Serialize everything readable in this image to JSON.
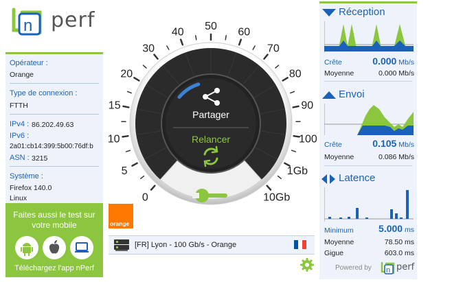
{
  "brand": {
    "name": "perf",
    "logo_letter": "n",
    "primary": "#1a62b8",
    "accent": "#8cc63f"
  },
  "sidebar": {
    "operator_label": "Opérateur :",
    "operator_value": "Orange",
    "connection_label": "Type de connexion :",
    "connection_value": "FTTH",
    "ipv4_label": "IPv4 :",
    "ipv4_value": "86.202.49.63",
    "ipv6_label": "IPv6 :",
    "ipv6_value": "2a01:cb14:399:5b00:76df:b",
    "asn_label": "ASN :",
    "asn_value": "3215",
    "system_label": "Système :",
    "system_browser": "Firefox 140.0",
    "system_os": "Linux"
  },
  "mobile_promo": {
    "title_line1": "Faites aussi le test sur",
    "title_line2": "votre mobile",
    "footer": "Téléchargez l'app nPerf",
    "icons": [
      "android-icon",
      "apple-icon",
      "desktop-icon"
    ]
  },
  "isp_logo": {
    "text": "orange",
    "color": "#ff7900"
  },
  "gauge": {
    "scale_labels": [
      "0",
      "5",
      "10",
      "15",
      "20",
      "30",
      "40",
      "50",
      "60",
      "70",
      "80",
      "90",
      "100",
      "1Gb",
      "10Gb"
    ],
    "share_label": "Partager",
    "restart_label": "Relancer",
    "progress": 0.18
  },
  "server": {
    "text": "[FR] Lyon - 100 Gb/s - Orange",
    "icons": [
      "server-icon",
      "france-flag-icon"
    ]
  },
  "results": {
    "reception": {
      "title": "Réception",
      "peak_label": "Crête",
      "peak_value": "0.000",
      "peak_unit": "Mb/s",
      "avg_label": "Moyenne",
      "avg_value": "0.000 Mb/s"
    },
    "upload": {
      "title": "Envoi",
      "peak_label": "Crête",
      "peak_value": "0.105",
      "peak_unit": "Mb/s",
      "avg_label": "Moyenne",
      "avg_value": "0.086 Mb/s"
    },
    "latency": {
      "title": "Latence",
      "min_label": "Minimum",
      "min_value": "5.000",
      "min_unit": "ms",
      "avg_label": "Moyenne",
      "avg_value": "78.50 ms",
      "jitter_label": "Gigue",
      "jitter_value": "603.0 ms"
    }
  },
  "footer": {
    "powered_by": "Powered by",
    "brand": "perf",
    "brand_letter": "n"
  }
}
